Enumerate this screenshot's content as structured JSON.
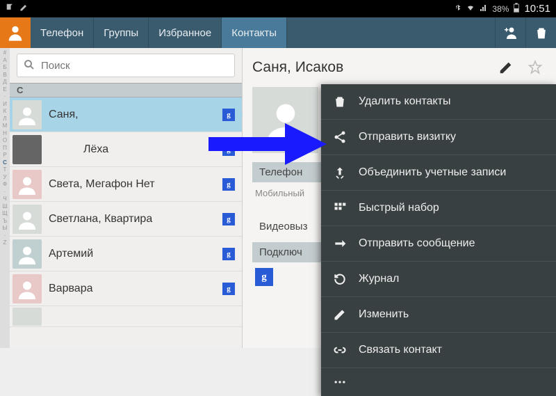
{
  "status": {
    "battery": "38%",
    "time": "10:51"
  },
  "tabs": {
    "phone": "Телефон",
    "groups": "Группы",
    "fav": "Избранное",
    "contacts": "Контакты"
  },
  "search": {
    "placeholder": "Поиск"
  },
  "section_letter": "С",
  "index_letters": [
    "#",
    "А",
    "Б",
    "В",
    "Д",
    "Е",
    "И",
    "К",
    "Л",
    "М",
    "Н",
    "О",
    "П",
    "Р",
    "С",
    "Т",
    "У",
    "Ф",
    "·",
    "Ч",
    "Ш",
    "Щ",
    "Ъ",
    "Ы",
    "·",
    "Z"
  ],
  "contacts": [
    {
      "name": "Саня,"
    },
    {
      "name": "Лёха"
    },
    {
      "name": "Света, Мегафон Нет"
    },
    {
      "name": "Светлана, Квартира"
    },
    {
      "name": "Артемий"
    },
    {
      "name": "Варвара"
    }
  ],
  "detail": {
    "title": "Саня, Исаков",
    "section_phone": "Телефон",
    "label_mobile": "Мобильный",
    "section_video": "Видеовыз",
    "section_connect": "Подключ"
  },
  "menu": {
    "delete": "Удалить контакты",
    "share": "Отправить визитку",
    "merge": "Объединить учетные записи",
    "speed": "Быстрый набор",
    "send": "Отправить сообщение",
    "log": "Журнал",
    "edit": "Изменить",
    "link": "Связать контакт"
  }
}
